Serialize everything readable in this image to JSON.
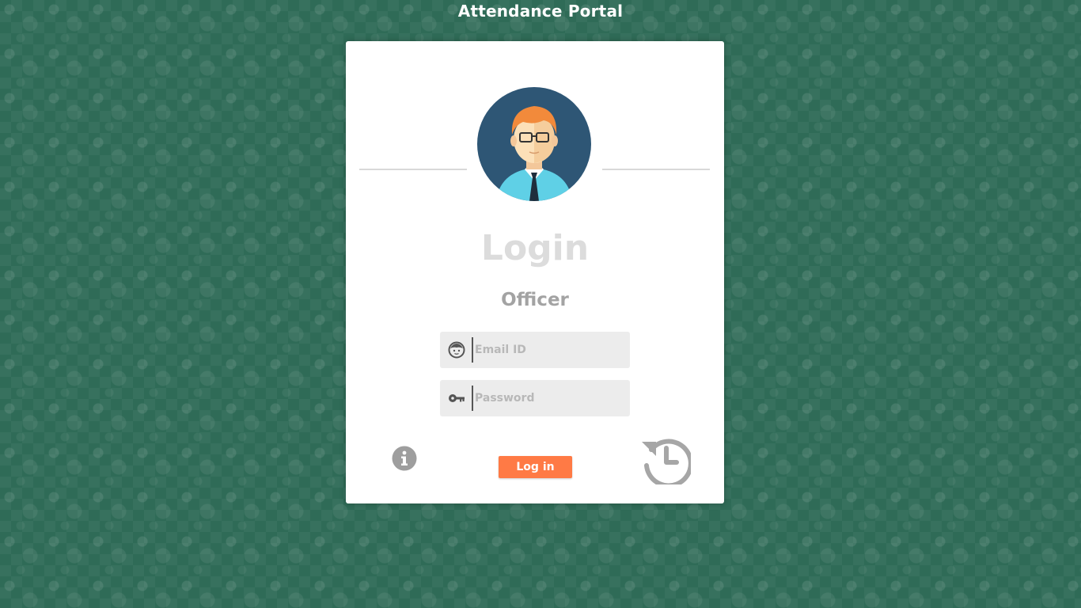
{
  "header": {
    "title": "Attendance Portal"
  },
  "card": {
    "heading": "Login",
    "role": "Officer",
    "email": {
      "placeholder": "Email ID",
      "value": "",
      "icon": "face-icon"
    },
    "password": {
      "placeholder": "Password",
      "value": "",
      "icon": "key-icon"
    },
    "login_button_label": "Log in",
    "info_icon": "info-icon",
    "history_icon": "history-icon",
    "avatar_icon": "officer-avatar"
  },
  "colors": {
    "background": "#2f6b57",
    "login_button": "#ff7a45",
    "heading": "#dcdcdc",
    "role": "#a3a3a3",
    "field_bg": "#ececec",
    "icon_gray": "#9e9e9e"
  }
}
